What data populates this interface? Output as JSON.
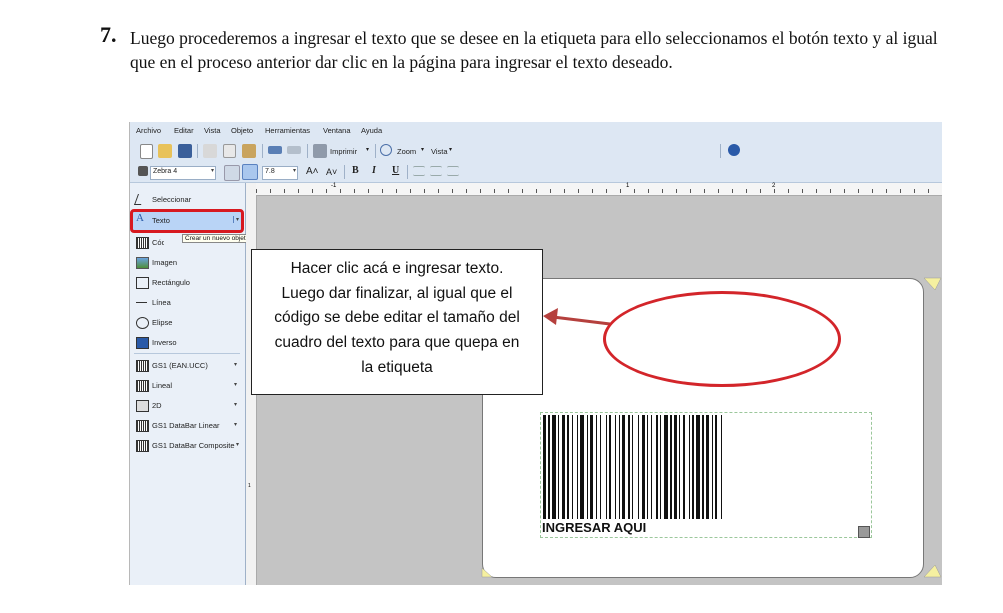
{
  "instruction": {
    "number": "7.",
    "text": "Luego procederemos a ingresar el texto que se desee en la etiqueta para ello seleccionamos el botón texto y al igual que en el proceso anterior dar clic en la página para ingresar el texto deseado."
  },
  "menu": [
    "Archivo",
    "Editar",
    "Vista",
    "Objeto",
    "Herramientas",
    "Ventana",
    "Ayuda"
  ],
  "toolbar": {
    "print_label": "Imprimir",
    "zoom_label": "Zoom",
    "view_label": "Vista",
    "printer_value": "Zebra 4",
    "font_size_value": "7.8",
    "bold": "B",
    "italic": "I",
    "underline": "U"
  },
  "panel": {
    "items": [
      {
        "label": "Seleccionar",
        "icon": "cursor-icon"
      },
      {
        "label": "Texto",
        "icon": "text-a-icon"
      },
      {
        "label": "Código de barras",
        "icon": "barcode-icon"
      },
      {
        "label": "Imagen",
        "icon": "image-icon"
      },
      {
        "label": "Rectángulo",
        "icon": "rectangle-icon"
      },
      {
        "label": "Línea",
        "icon": "line-icon"
      },
      {
        "label": "Elipse",
        "icon": "ellipse-icon"
      },
      {
        "label": "Inverso",
        "icon": "inverse-icon"
      },
      {
        "label": "GS1 (EAN.UCC)",
        "icon": "barcode-icon"
      },
      {
        "label": "Lineal",
        "icon": "barcode-icon"
      },
      {
        "label": "2D",
        "icon": "qr-icon"
      },
      {
        "label": "GS1 DataBar Linear",
        "icon": "barcode-icon"
      },
      {
        "label": "GS1 DataBar Composite",
        "icon": "barcode-icon"
      }
    ],
    "tooltip": "Crear un nuevo objeto de texto"
  },
  "ruler": {
    "marks": [
      "-1",
      "1",
      "2"
    ]
  },
  "callout": {
    "lines": [
      "Hacer clic acá e ingresar texto.",
      "Luego dar finalizar, al igual que el",
      "código se debe editar el tamaño del",
      "cuadro del texto para que quepa en",
      "la etiqueta"
    ]
  },
  "barcode": {
    "text": "INGRESAR AQUI"
  },
  "colors": {
    "highlight_red": "#d71920",
    "ellipse_red": "#d3252a",
    "toolbar_bg": "#dde7f3"
  }
}
